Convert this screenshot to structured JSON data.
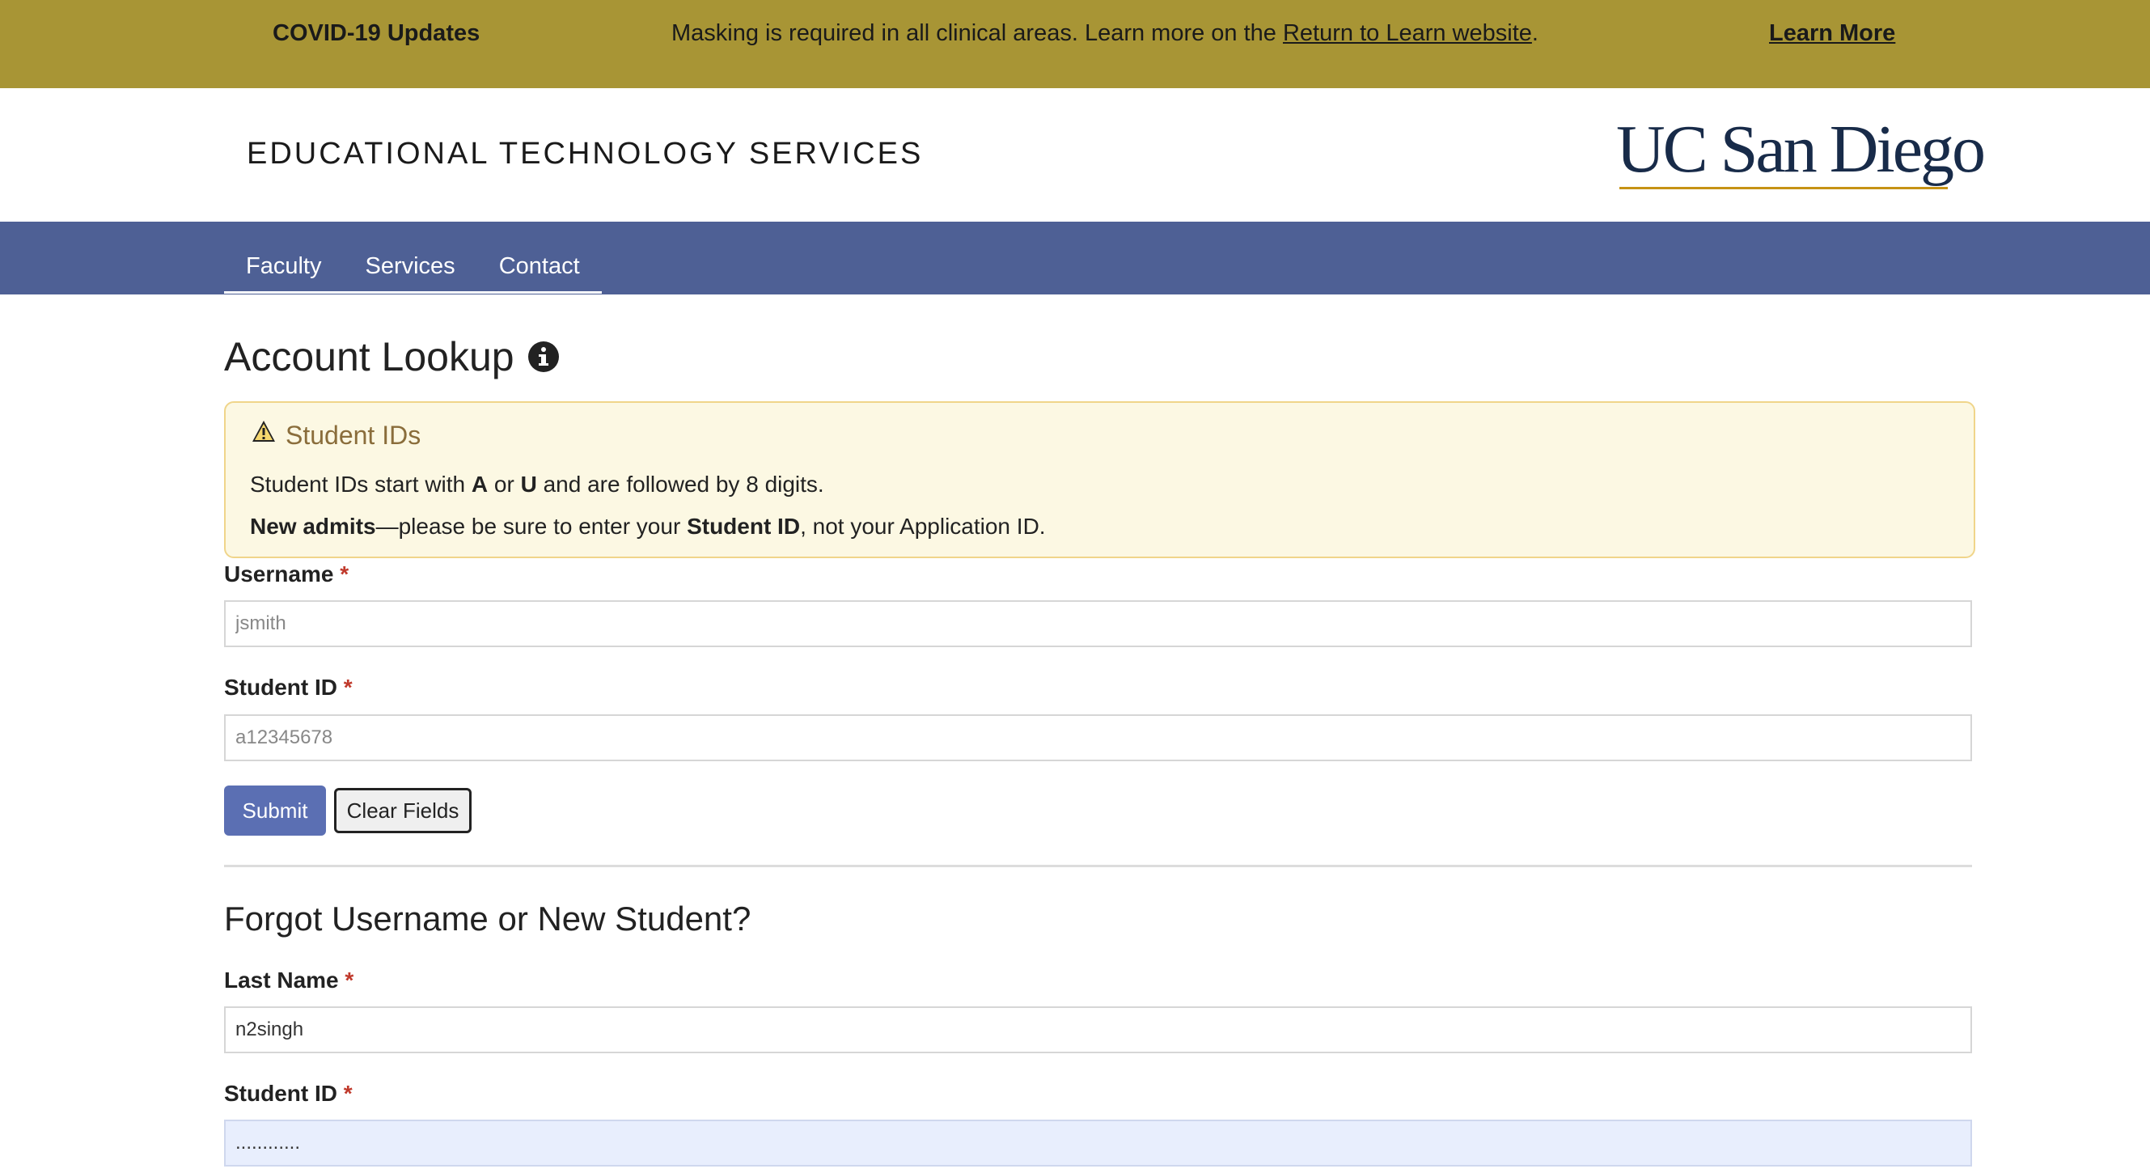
{
  "banner": {
    "title": "COVID-19 Updates",
    "message_prefix": "Masking is required in all clinical areas. Learn more on the ",
    "message_link": "Return to Learn website",
    "message_suffix": ".",
    "learn_more": "Learn More",
    "background_color": "#a89535"
  },
  "header": {
    "site_title": "EDUCATIONAL TECHNOLOGY SERVICES",
    "logo_text": "UC San Diego"
  },
  "nav": {
    "background_color": "#4e6095",
    "items": [
      {
        "label": "Faculty"
      },
      {
        "label": "Services"
      },
      {
        "label": "Contact"
      }
    ]
  },
  "page": {
    "title": "Account Lookup",
    "title_icon": "info-circle-icon"
  },
  "alert": {
    "icon": "warning-icon",
    "title": "Student IDs",
    "line1": {
      "t1": "Student IDs start with ",
      "b1": "A",
      "t2": " or ",
      "b2": "U",
      "t3": " and are followed by 8 digits."
    },
    "line2": {
      "b1": "New admits",
      "t1": "—please be sure to enter your ",
      "b2": "Student ID",
      "t2": ", not your Application ID."
    }
  },
  "lookup_form": {
    "username_label": "Username",
    "username_placeholder": "jsmith",
    "username_value": "",
    "student_id_label": "Student ID",
    "student_id_placeholder": "a12345678",
    "student_id_value": "",
    "required_mark": "*",
    "submit_label": "Submit",
    "clear_label": "Clear Fields"
  },
  "forgot_form": {
    "title": "Forgot Username or New Student?",
    "last_name_label": "Last Name",
    "last_name_value": "n2singh",
    "student_id_label": "Student ID",
    "student_id_value": "............",
    "required_mark": "*"
  }
}
